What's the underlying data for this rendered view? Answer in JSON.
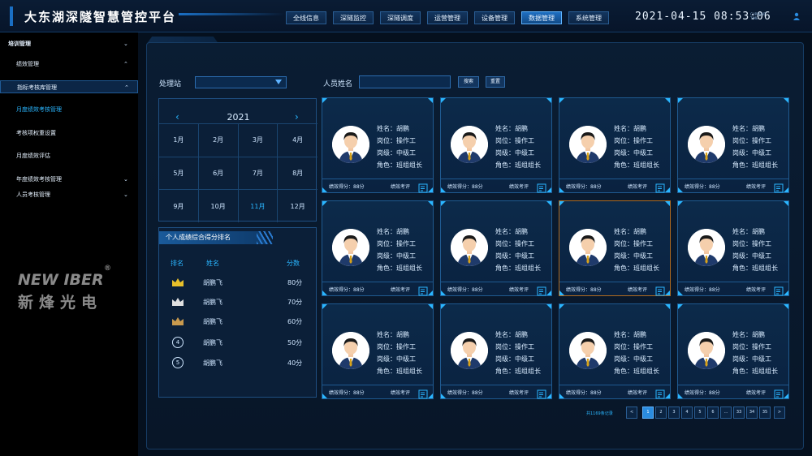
{
  "header": {
    "title": "大东湖深隧智慧管控平台",
    "tabs": [
      {
        "label": "全线信息",
        "active": false
      },
      {
        "label": "深隧监控",
        "active": false
      },
      {
        "label": "深隧调度",
        "active": false
      },
      {
        "label": "运营管理",
        "active": false
      },
      {
        "label": "设备管理",
        "active": false
      },
      {
        "label": "数据管理",
        "active": true
      },
      {
        "label": "系统管理",
        "active": false
      }
    ],
    "clock": "2021-04-15 08:53:06",
    "current_time_label_1": "CURRENT",
    "current_time_label_2": "TIME"
  },
  "sidebar": {
    "items": [
      {
        "label": "培训管理",
        "chev": "⌄"
      },
      {
        "label": "绩效管理",
        "chev": "⌃"
      },
      {
        "label": "指标考核库管理",
        "chev": "⌃"
      },
      {
        "label": "月度绩效考核管理",
        "chev": ""
      },
      {
        "label": "考核项权重设置",
        "chev": ""
      },
      {
        "label": "月度绩效评估",
        "chev": ""
      },
      {
        "label": "年度绩效考核管理",
        "chev": "⌄"
      },
      {
        "label": "人员考核管理",
        "chev": "⌄"
      }
    ],
    "brand_en": "NEW IBER",
    "brand_reg": "®",
    "brand_cn": "新烽光电"
  },
  "filters": {
    "station_label": "处理站",
    "station_value": "",
    "name_label": "人员姓名",
    "name_value": "",
    "search_label": "搜索",
    "reset_label": "重置"
  },
  "calendar": {
    "year": "2021",
    "prev": "‹",
    "next": "›",
    "months": [
      "1月",
      "2月",
      "3月",
      "4月",
      "5月",
      "6月",
      "7月",
      "8月",
      "9月",
      "10月",
      "11月",
      "12月"
    ],
    "selected_month": "11月"
  },
  "ranking": {
    "title": "个人成绩综合得分排名",
    "col_rank": "排名",
    "col_name": "姓名",
    "col_score": "分数",
    "rows": [
      {
        "rank": "1",
        "medal": "gold-crown",
        "name": "胡鹏飞",
        "score": "80分"
      },
      {
        "rank": "2",
        "medal": "silver-crown",
        "name": "胡鹏飞",
        "score": "70分"
      },
      {
        "rank": "3",
        "medal": "bronze-crown",
        "name": "胡鹏飞",
        "score": "60分"
      },
      {
        "rank": "4",
        "medal": "",
        "name": "胡鹏飞",
        "score": "50分"
      },
      {
        "rank": "5",
        "medal": "",
        "name": "胡鹏飞",
        "score": "40分"
      }
    ]
  },
  "cards": [
    {
      "name": "姓名：胡鹏",
      "post": "岗位：操作工",
      "level": "岗级：中级工",
      "role": "角色：班组组长",
      "score": "绩效得分：88分",
      "eval": "绩效考评"
    },
    {
      "name": "姓名：胡鹏",
      "post": "岗位：操作工",
      "level": "岗级：中级工",
      "role": "角色：班组组长",
      "score": "绩效得分：88分",
      "eval": "绩效考评"
    },
    {
      "name": "姓名：胡鹏",
      "post": "岗位：操作工",
      "level": "岗级：中级工",
      "role": "角色：班组组长",
      "score": "绩效得分：88分",
      "eval": "绩效考评"
    },
    {
      "name": "姓名：胡鹏",
      "post": "岗位：操作工",
      "level": "岗级：中级工",
      "role": "角色：班组组长",
      "score": "绩效得分：88分",
      "eval": "绩效考评"
    },
    {
      "name": "姓名：胡鹏",
      "post": "岗位：操作工",
      "level": "岗级：中级工",
      "role": "角色：班组组长",
      "score": "绩效得分：88分",
      "eval": "绩效考评"
    },
    {
      "name": "姓名：胡鹏",
      "post": "岗位：操作工",
      "level": "岗级：中级工",
      "role": "角色：班组组长",
      "score": "绩效得分：88分",
      "eval": "绩效考评"
    },
    {
      "name": "姓名：胡鹏",
      "post": "岗位：操作工",
      "level": "岗级：中级工",
      "role": "角色：班组组长",
      "score": "绩效得分：88分",
      "eval": "绩效考评"
    },
    {
      "name": "姓名：胡鹏",
      "post": "岗位：操作工",
      "level": "岗级：中级工",
      "role": "角色：班组组长",
      "score": "绩效得分：88分",
      "eval": "绩效考评"
    },
    {
      "name": "姓名：胡鹏",
      "post": "岗位：操作工",
      "level": "岗级：中级工",
      "role": "角色：班组组长",
      "score": "绩效得分：88分",
      "eval": "绩效考评"
    },
    {
      "name": "姓名：胡鹏",
      "post": "岗位：操作工",
      "level": "岗级：中级工",
      "role": "角色：班组组长",
      "score": "绩效得分：88分",
      "eval": "绩效考评"
    },
    {
      "name": "姓名：胡鹏",
      "post": "岗位：操作工",
      "level": "岗级：中级工",
      "role": "角色：班组组长",
      "score": "绩效得分：88分",
      "eval": "绩效考评"
    },
    {
      "name": "姓名：胡鹏",
      "post": "岗位：操作工",
      "level": "岗级：中级工",
      "role": "角色：班组组长",
      "score": "绩效得分：88分",
      "eval": "绩效考评"
    }
  ],
  "selected_card_index": 6,
  "pagination": {
    "total": "共1169条记录",
    "prev": "<",
    "next": ">",
    "pages": [
      "1",
      "2",
      "3",
      "4",
      "5",
      "6",
      "…",
      "33",
      "34",
      "35"
    ],
    "current": "1"
  },
  "colors": {
    "accent": "#2ab6ff",
    "selected_border": "#b06a1e",
    "gold": "#e8c02a",
    "silver": "#e0e0e0",
    "bronze": "#c99a4e"
  }
}
